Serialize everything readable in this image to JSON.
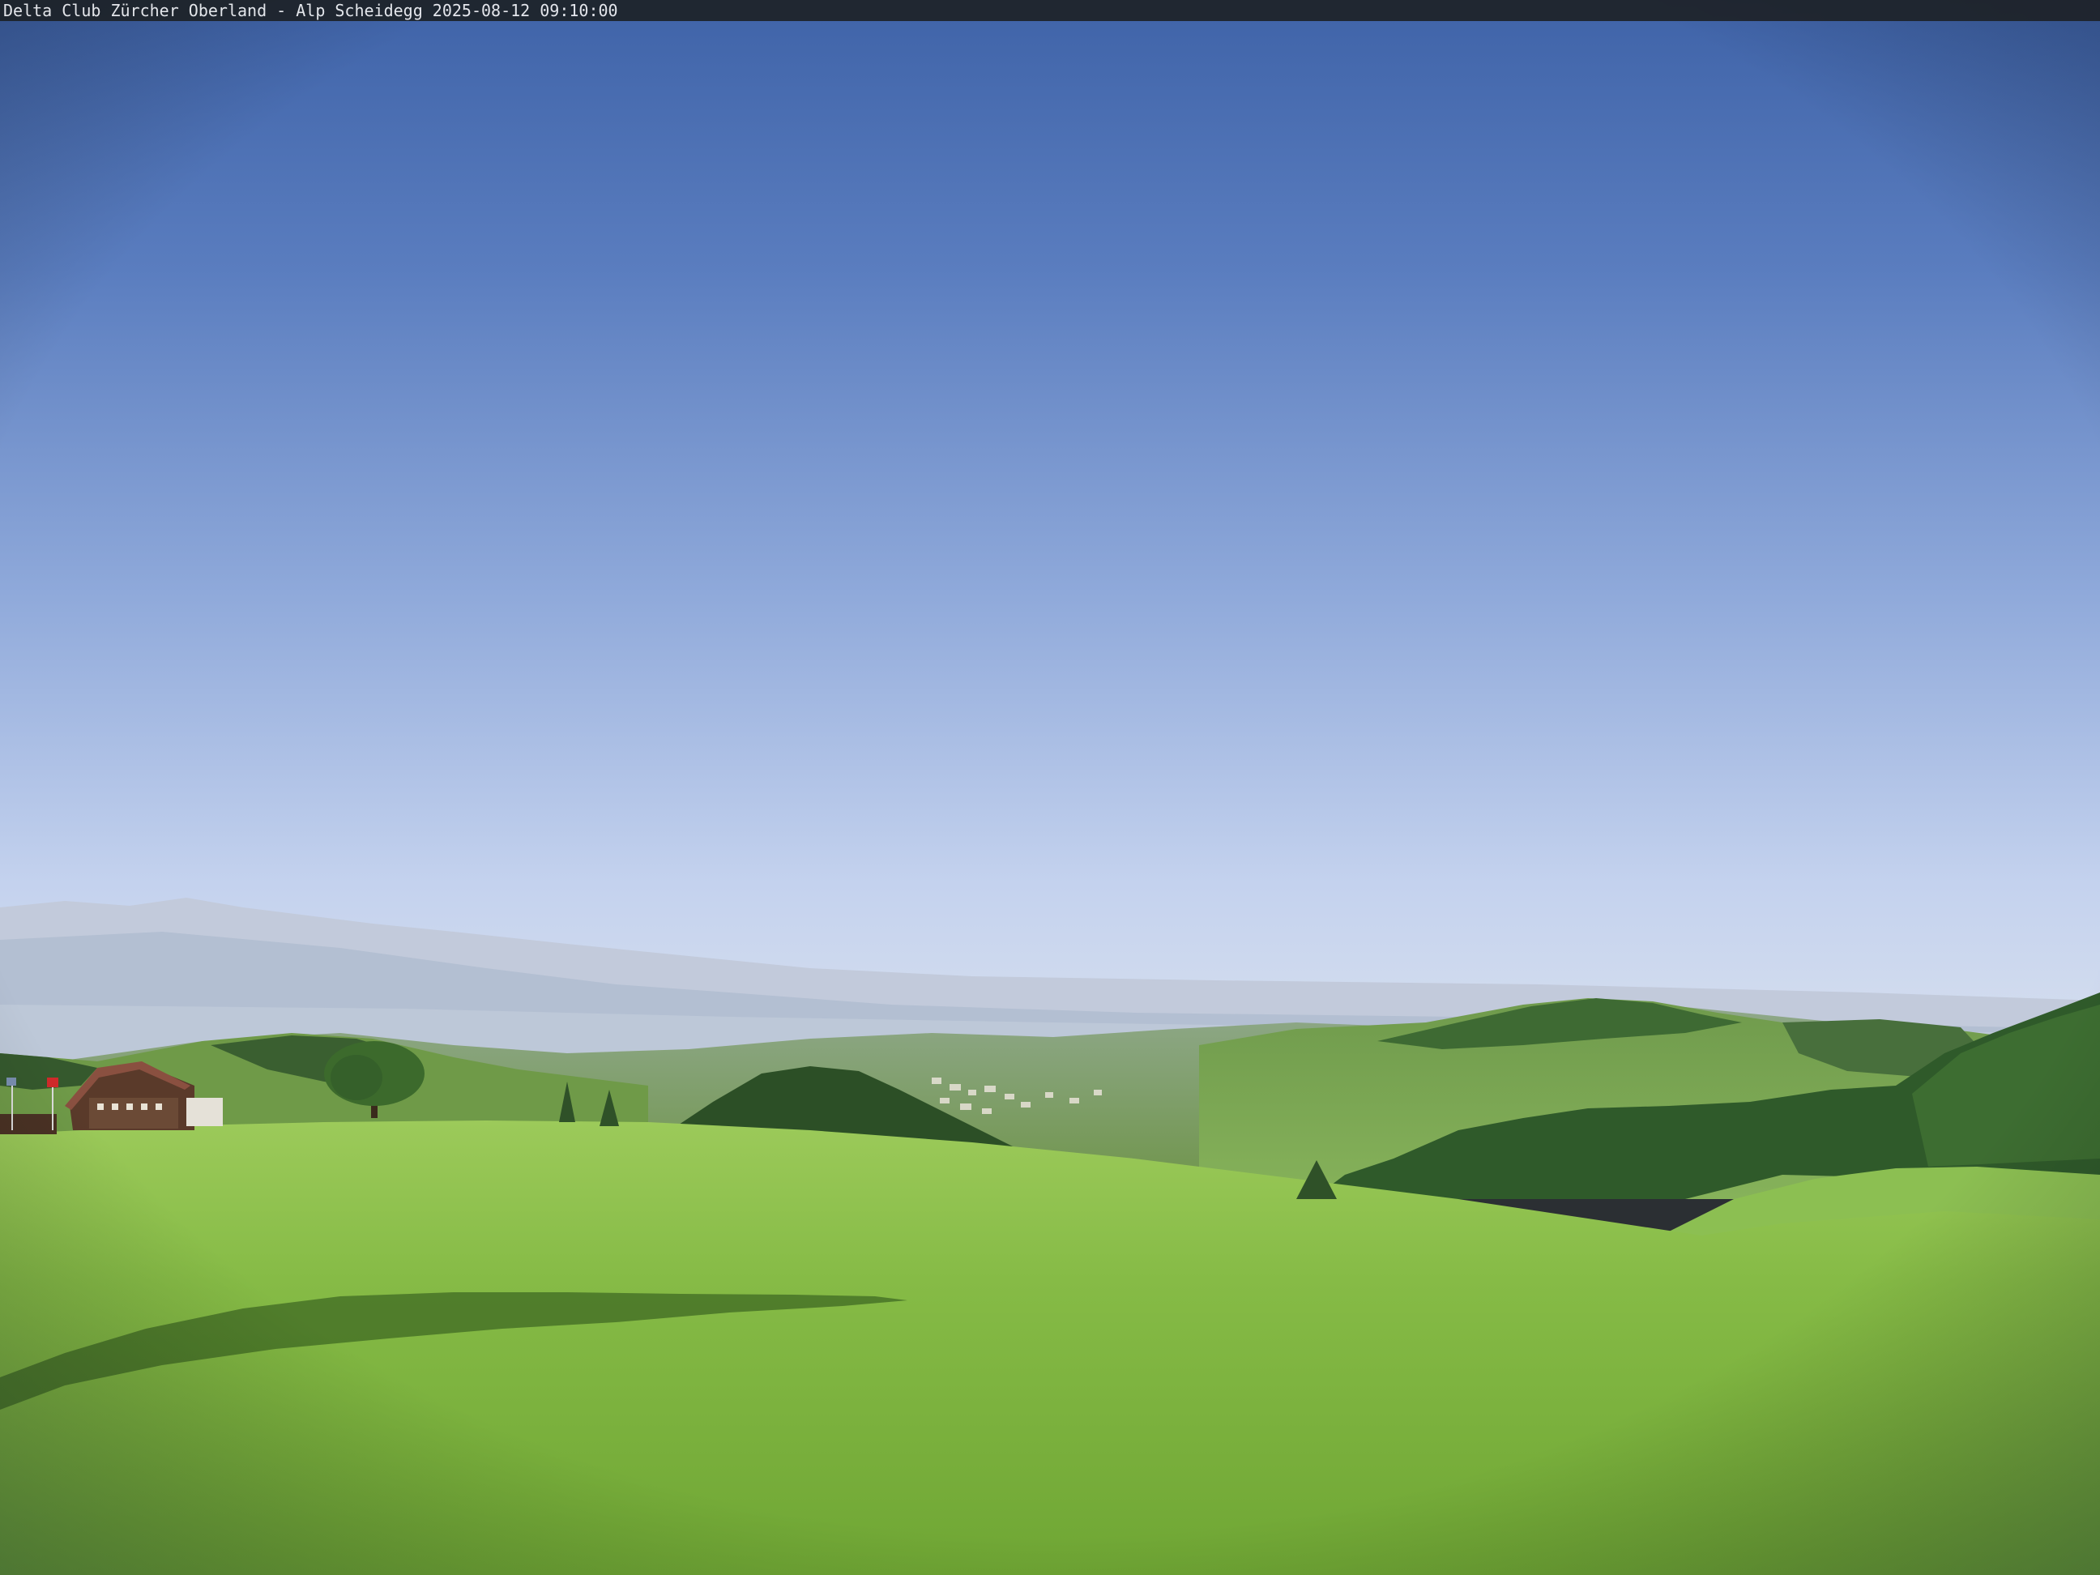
{
  "overlay": {
    "caption": "Delta Club Zürcher Oberland - Alp Scheidegg 2025-08-12 09:10:00"
  },
  "scene": {
    "content": "webcam photo: clear blue sky, hazy distant Alps, forested hills, village in valley, green meadow in foreground with farmhouse on left",
    "colors": {
      "sky_top": "#4468ad",
      "sky_horizon": "#d4def0",
      "haze": "#c9d3e4",
      "far_hills": "#a8b5c8",
      "forest": "#2f5a2a",
      "meadow_light": "#8fc24f",
      "meadow_dark": "#5d9a2e",
      "shadow": "#2e4a1a"
    }
  }
}
